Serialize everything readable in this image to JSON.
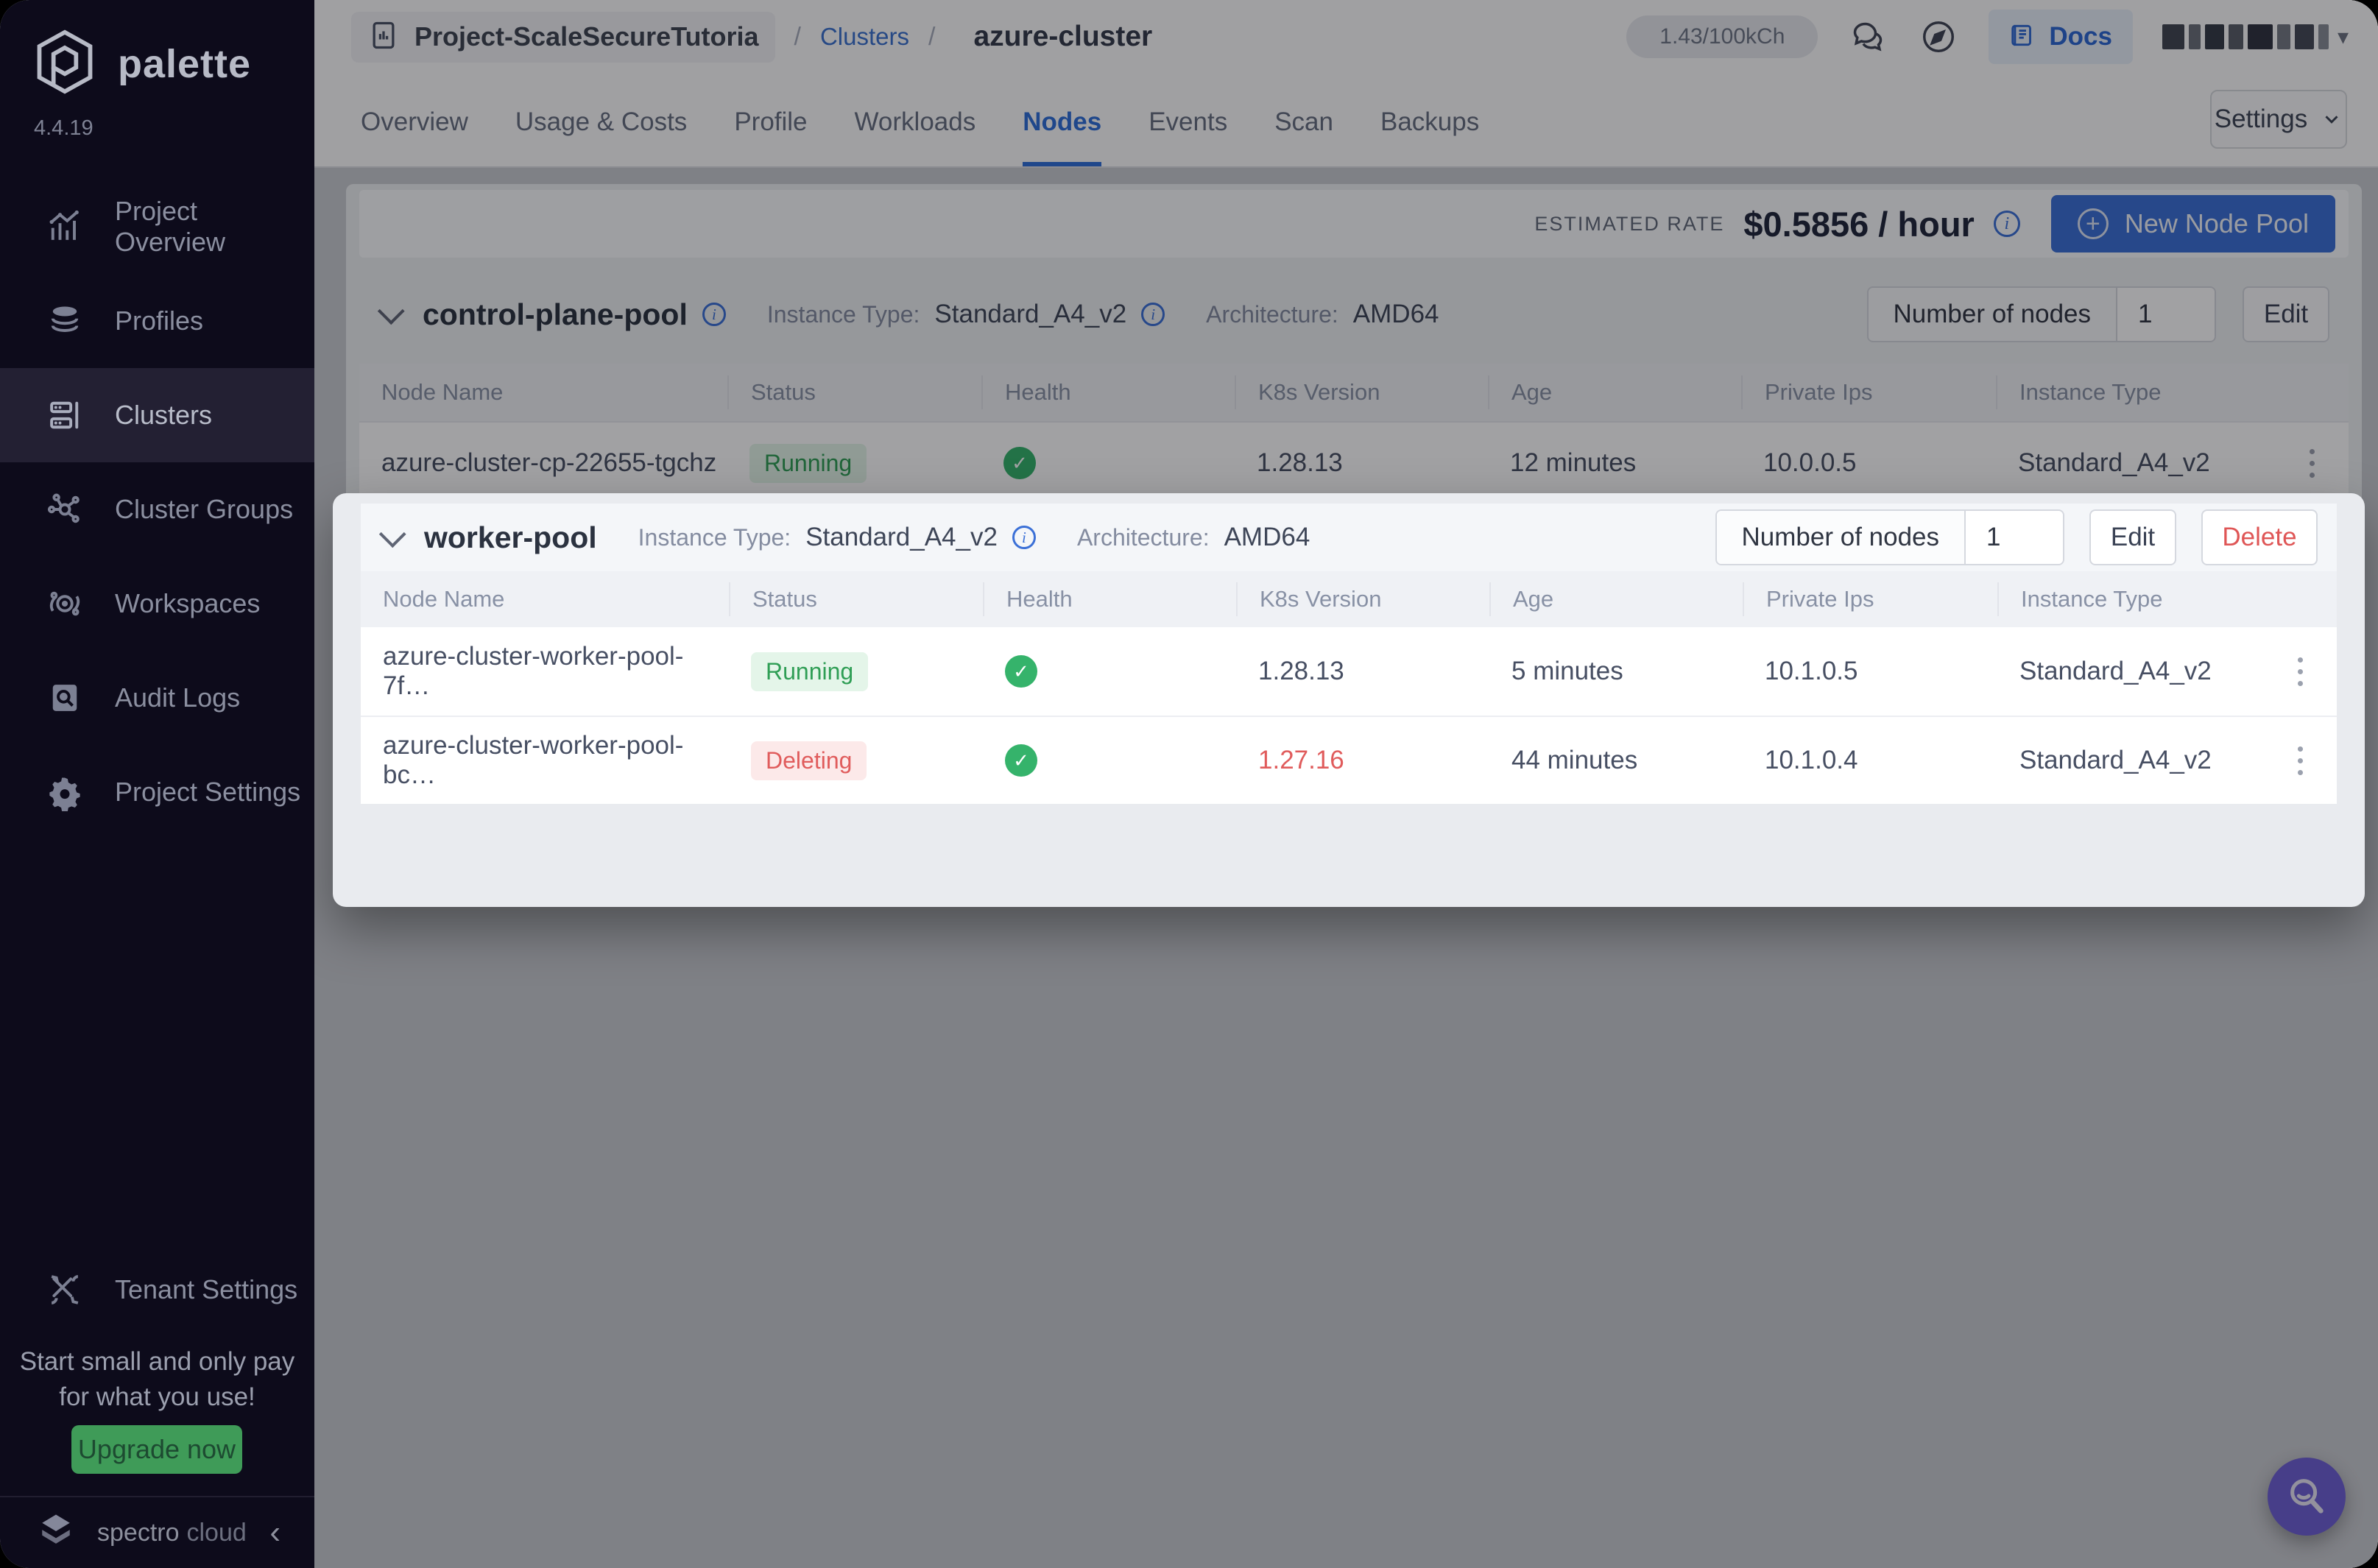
{
  "colors": {
    "accent_blue": "#3b70d7",
    "status_green": "#2f9e55",
    "status_red": "#e05c5c",
    "upgrade_green": "#3f9b58",
    "help_purple": "#6e5fd6",
    "sidebar_bg": "#0d0b1b"
  },
  "sidebar": {
    "logo_text": "palette",
    "version": "4.4.19",
    "items": [
      {
        "label": "Project Overview",
        "icon": "chart-icon"
      },
      {
        "label": "Profiles",
        "icon": "layers-icon"
      },
      {
        "label": "Clusters",
        "icon": "server-icon"
      },
      {
        "label": "Cluster Groups",
        "icon": "network-icon"
      },
      {
        "label": "Workspaces",
        "icon": "orbit-icon"
      },
      {
        "label": "Audit Logs",
        "icon": "audit-icon"
      },
      {
        "label": "Project Settings",
        "icon": "gear-icon"
      }
    ],
    "active_item": "Clusters",
    "tenant_settings_label": "Tenant Settings",
    "promo_line1": "Start small and only pay",
    "promo_line2": "for what you use!",
    "upgrade_button": "Upgrade now",
    "brand_word1": "spectro",
    "brand_word2": "cloud",
    "collapse_icon": "‹"
  },
  "topbar": {
    "breadcrumb": {
      "project": "Project-ScaleSecureTutoria",
      "sep": "/",
      "section": "Clusters",
      "current": "azure-cluster"
    },
    "usage_pill": "1.43/100kCh",
    "docs_label": "Docs"
  },
  "tabs": {
    "items": [
      "Overview",
      "Usage & Costs",
      "Profile",
      "Workloads",
      "Nodes",
      "Events",
      "Scan",
      "Backups"
    ],
    "active": "Nodes",
    "settings_label": "Settings"
  },
  "rate_bar": {
    "label": "ESTIMATED RATE",
    "value": "$0.5856 / hour",
    "new_pool_button": "New Node Pool"
  },
  "columns": [
    "Node Name",
    "Status",
    "Health",
    "K8s Version",
    "Age",
    "Private Ips",
    "Instance Type"
  ],
  "pools": [
    {
      "name": "control-plane-pool",
      "instance_type_label": "Instance Type:",
      "instance_type": "Standard_A4_v2",
      "architecture_label": "Architecture:",
      "architecture": "AMD64",
      "nodes_label": "Number of nodes",
      "nodes_count": "1",
      "edit_label": "Edit",
      "rows": [
        {
          "name": "azure-cluster-cp-22655-tgchz",
          "status": "Running",
          "k8s": "1.28.13",
          "age": "12 minutes",
          "ip": "10.0.0.5",
          "instance": "Standard_A4_v2"
        }
      ]
    },
    {
      "name": "worker-pool",
      "instance_type_label": "Instance Type:",
      "instance_type": "Standard_A4_v2",
      "architecture_label": "Architecture:",
      "architecture": "AMD64",
      "nodes_label": "Number of nodes",
      "nodes_count": "1",
      "edit_label": "Edit",
      "delete_label": "Delete",
      "rows": [
        {
          "name": "azure-cluster-worker-pool-7f…",
          "status": "Running",
          "k8s": "1.28.13",
          "age": "5 minutes",
          "ip": "10.1.0.5",
          "instance": "Standard_A4_v2"
        },
        {
          "name": "azure-cluster-worker-pool-bc…",
          "status": "Deleting",
          "k8s": "1.27.16",
          "age": "44 minutes",
          "ip": "10.1.0.4",
          "instance": "Standard_A4_v2"
        }
      ]
    }
  ]
}
